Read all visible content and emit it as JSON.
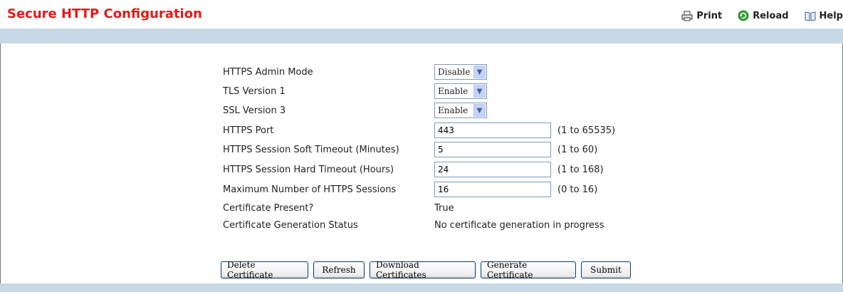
{
  "header": {
    "title": "Secure HTTP Configuration",
    "print_label": "Print",
    "reload_label": "Reload",
    "help_label": "Help"
  },
  "form": {
    "admin_mode": {
      "label": "HTTPS Admin Mode",
      "value": "Disable"
    },
    "tls_v1": {
      "label": "TLS Version 1",
      "value": "Enable"
    },
    "ssl_v3": {
      "label": "SSL Version 3",
      "value": "Enable"
    },
    "port": {
      "label": "HTTPS Port",
      "value": "443",
      "range": "(1 to 65535)"
    },
    "soft_timeout": {
      "label": "HTTPS Session Soft Timeout (Minutes)",
      "value": "5",
      "range": "(1 to 60)"
    },
    "hard_timeout": {
      "label": "HTTPS Session Hard Timeout (Hours)",
      "value": "24",
      "range": "(1 to 168)"
    },
    "max_sessions": {
      "label": "Maximum Number of HTTPS Sessions",
      "value": "16",
      "range": "(0 to 16)"
    },
    "cert_present": {
      "label": "Certificate Present?",
      "value": "True"
    },
    "cert_status": {
      "label": "Certificate Generation Status",
      "value": "No certificate generation in progress"
    }
  },
  "buttons": {
    "delete_cert": "Delete Certificate",
    "refresh": "Refresh",
    "download_certs": "Download Certificates",
    "generate_cert": "Generate Certificate",
    "submit": "Submit"
  },
  "colors": {
    "title": "#e01b1b",
    "bar": "#c8d9e6"
  }
}
